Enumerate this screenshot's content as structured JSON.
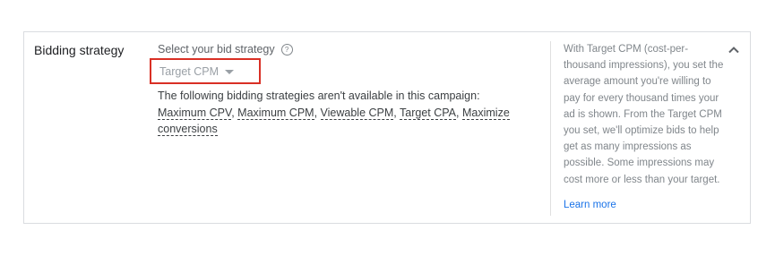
{
  "section": {
    "title": "Bidding strategy"
  },
  "bid_strategy": {
    "prompt": "Select your bid strategy",
    "help_icon": "help-circle-icon",
    "selected_value": "Target CPM",
    "unavailable_notice": "The following bidding strategies aren't available in this campaign:",
    "unavailable_strategies": [
      {
        "label": "Maximum CPV",
        "separator": ", "
      },
      {
        "label": "Maximum CPM",
        "separator": ", "
      },
      {
        "label": "Viewable CPM",
        "separator": ", "
      },
      {
        "label": "Target CPA",
        "separator": ", "
      },
      {
        "label": "Maximize conversions",
        "separator": ""
      }
    ]
  },
  "help_panel": {
    "text": "With Target CPM (cost-per-thousand impressions), you set the average amount you're willing to pay for every thousand times your ad is shown. From the Target CPM you set, we'll optimize bids to help get as many impressions as possible. Some impressions may cost more or less than your target.",
    "learn_more": "Learn more",
    "collapse_icon": "chevron-up-icon"
  },
  "colors": {
    "highlight_border": "#d93025",
    "link": "#1a73e8",
    "muted_text": "#80868b",
    "border": "#dadce0"
  }
}
